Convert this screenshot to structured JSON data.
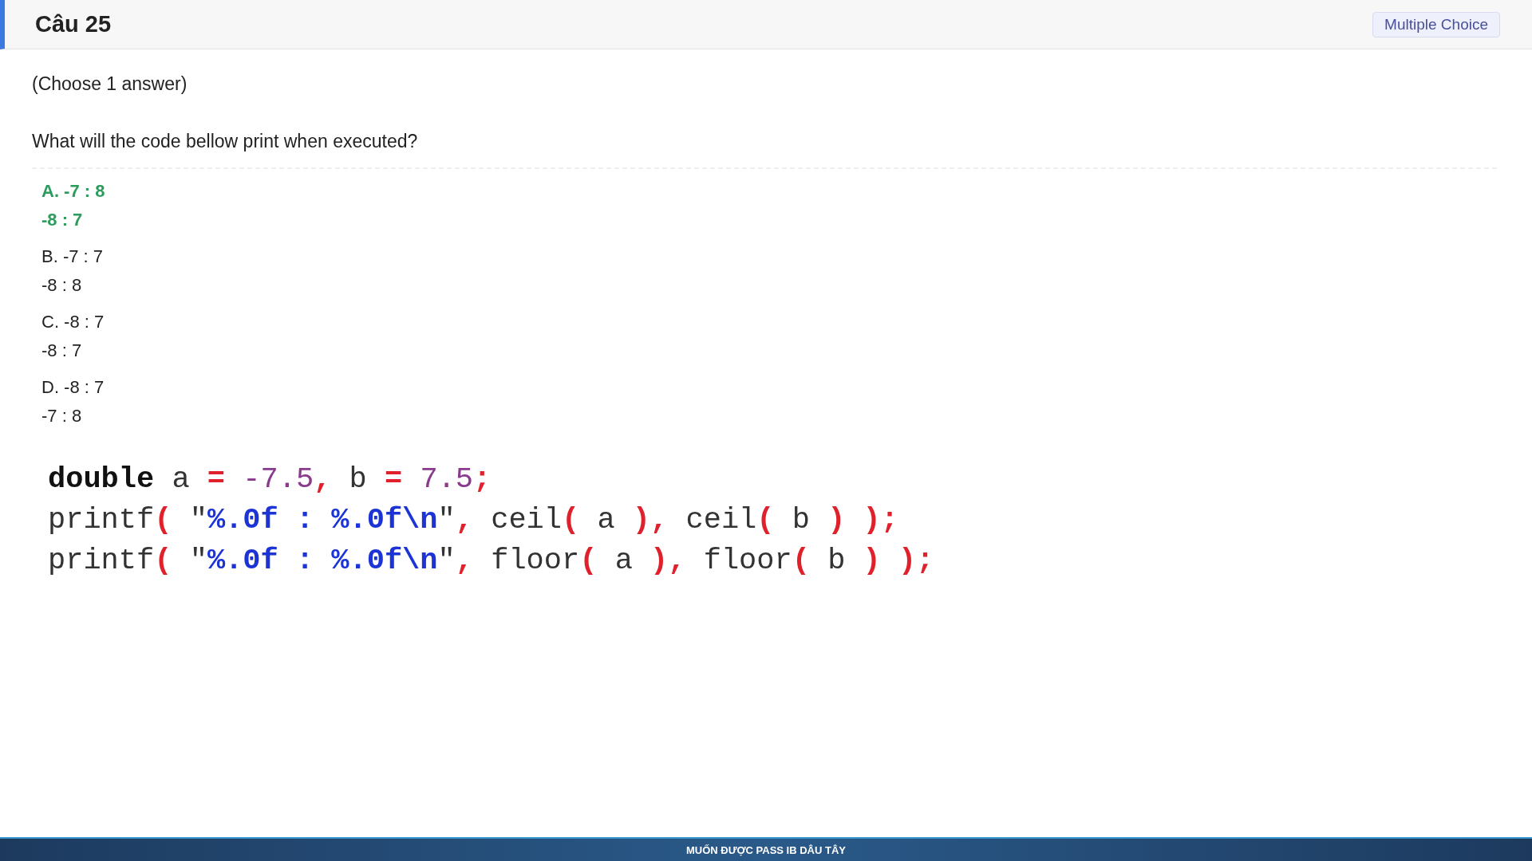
{
  "header": {
    "title": "Câu 25",
    "badge": "Multiple Choice"
  },
  "instruction": "(Choose 1 answer)",
  "question": "What will the code bellow print when executed?",
  "options": [
    {
      "lines": [
        "A. -7 : 8",
        "-8 : 7"
      ],
      "correct": true
    },
    {
      "lines": [
        "B. -7 : 7",
        "-8 : 8"
      ],
      "correct": false
    },
    {
      "lines": [
        "C. -8 : 7",
        "-8 : 7"
      ],
      "correct": false
    },
    {
      "lines": [
        "D. -8 : 7",
        "-7 : 8"
      ],
      "correct": false
    }
  ],
  "code": [
    [
      {
        "kind": "keyword",
        "text": "double"
      },
      {
        "kind": "plain",
        "text": " a "
      },
      {
        "kind": "operator",
        "text": "="
      },
      {
        "kind": "number",
        "text": " -7.5"
      },
      {
        "kind": "operator",
        "text": ","
      },
      {
        "kind": "plain",
        "text": " b "
      },
      {
        "kind": "operator",
        "text": "="
      },
      {
        "kind": "number",
        "text": " 7.5"
      },
      {
        "kind": "operator",
        "text": ";"
      }
    ],
    [
      {
        "kind": "plain",
        "text": "printf"
      },
      {
        "kind": "operator",
        "text": "("
      },
      {
        "kind": "plain",
        "text": " \""
      },
      {
        "kind": "string",
        "text": "%.0f : %.0f\\n"
      },
      {
        "kind": "plain",
        "text": "\""
      },
      {
        "kind": "operator",
        "text": ","
      },
      {
        "kind": "plain",
        "text": " ceil"
      },
      {
        "kind": "operator",
        "text": "("
      },
      {
        "kind": "plain",
        "text": " a "
      },
      {
        "kind": "operator",
        "text": "),"
      },
      {
        "kind": "plain",
        "text": " ceil"
      },
      {
        "kind": "operator",
        "text": "("
      },
      {
        "kind": "plain",
        "text": " b "
      },
      {
        "kind": "operator",
        "text": ")"
      },
      {
        "kind": "operator",
        "text": " );"
      }
    ],
    [
      {
        "kind": "plain",
        "text": "printf"
      },
      {
        "kind": "operator",
        "text": "("
      },
      {
        "kind": "plain",
        "text": " \""
      },
      {
        "kind": "string",
        "text": "%.0f : %.0f\\n"
      },
      {
        "kind": "plain",
        "text": "\""
      },
      {
        "kind": "operator",
        "text": ","
      },
      {
        "kind": "plain",
        "text": " floor"
      },
      {
        "kind": "operator",
        "text": "("
      },
      {
        "kind": "plain",
        "text": " a "
      },
      {
        "kind": "operator",
        "text": "),"
      },
      {
        "kind": "plain",
        "text": " floor"
      },
      {
        "kind": "operator",
        "text": "("
      },
      {
        "kind": "plain",
        "text": " b "
      },
      {
        "kind": "operator",
        "text": ")"
      },
      {
        "kind": "operator",
        "text": " );"
      }
    ]
  ],
  "banner": "MUỐN ĐƯỢC PASS IB DÂU TÂY"
}
